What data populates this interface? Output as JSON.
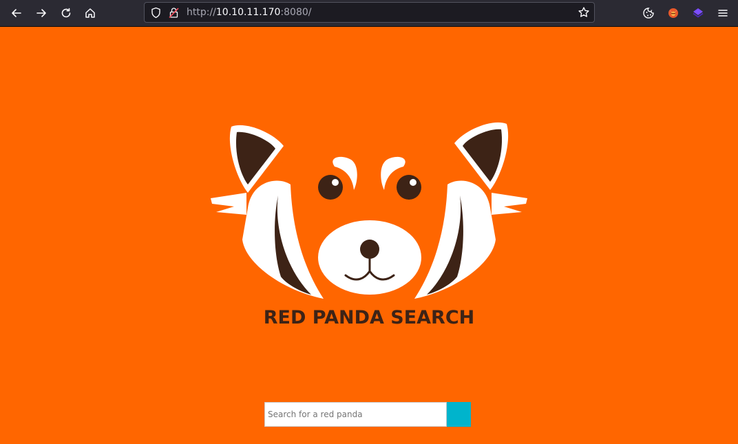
{
  "browser": {
    "url_scheme": "http://",
    "url_host": "10.10.11.170",
    "url_port": ":8080/",
    "back_icon": "arrow-left-icon",
    "forward_icon": "arrow-right-icon",
    "reload_icon": "reload-icon",
    "home_icon": "home-icon",
    "bookmark_icon": "star-icon",
    "extensions": [
      "cookie-icon",
      "foxyproxy-icon",
      "wappalyzer-icon"
    ],
    "menu_icon": "hamburger-menu-icon"
  },
  "page": {
    "title": "RED PANDA SEARCH",
    "search": {
      "placeholder": "Search for a red panda",
      "value": ""
    },
    "colors": {
      "background": "#ff6600",
      "button": "#00b4cc",
      "dark_brown": "#3d2316"
    }
  }
}
